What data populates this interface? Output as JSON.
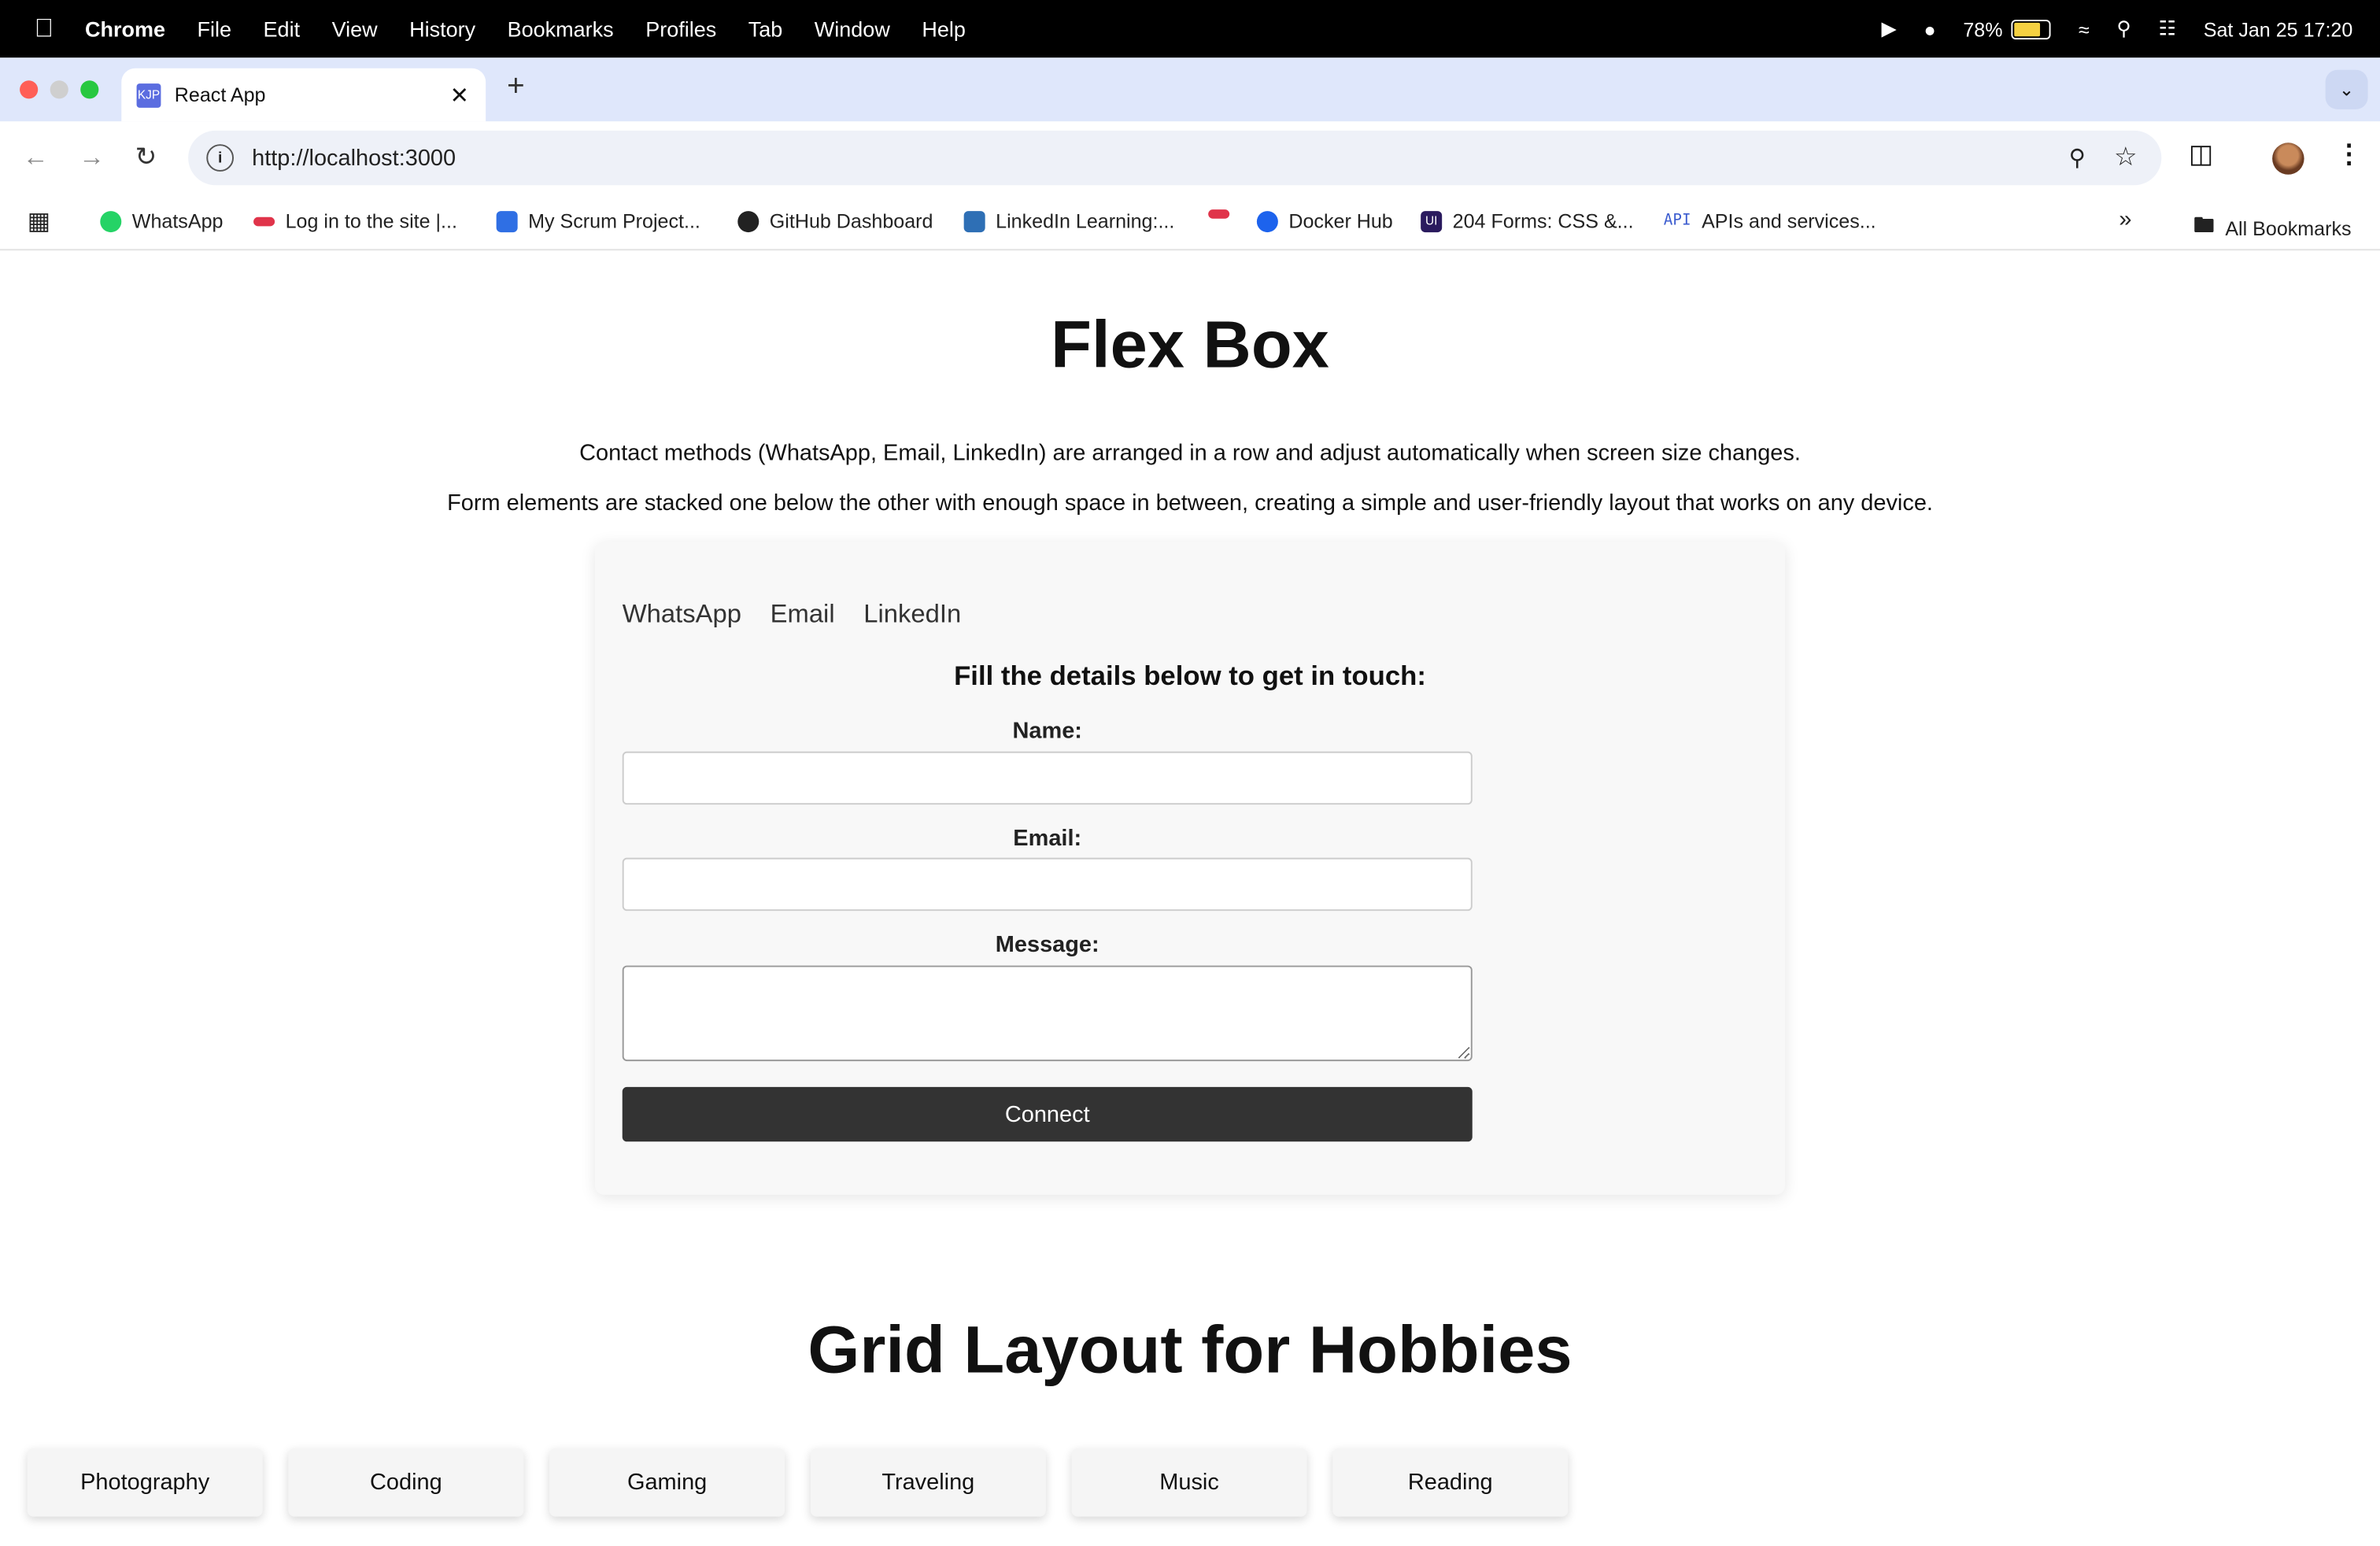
{
  "menubar": {
    "items": [
      "Chrome",
      "File",
      "Edit",
      "View",
      "History",
      "Bookmarks",
      "Profiles",
      "Tab",
      "Window",
      "Help"
    ],
    "battery": "78%",
    "datetime": "Sat Jan 25  17:20"
  },
  "tab": {
    "favicon_text": "KJP",
    "title": "React App"
  },
  "address": {
    "url": "http://localhost:3000"
  },
  "bookmarks": [
    {
      "label": "WhatsApp",
      "color": "#25d366"
    },
    {
      "label": "Log in to the site |...",
      "color": "#e0344a"
    },
    {
      "label": "My Scrum Project...",
      "color": "#2f6fe4"
    },
    {
      "label": "GitHub Dashboard",
      "color": "#222222"
    },
    {
      "label": "LinkedIn Learning:...",
      "color": "#2e6fb5"
    },
    {
      "label": "",
      "color": "#e0344a"
    },
    {
      "label": "Docker Hub",
      "color": "#1d63ed"
    },
    {
      "label": "204 Forms: CSS &...",
      "color": "#2a1a5e"
    },
    {
      "label": "APIs and services...",
      "color": "#3c5ccf"
    }
  ],
  "bookmarks_icon_texts": {
    "ui": "UI",
    "api": "API"
  },
  "all_bookmarks": "All Bookmarks",
  "page": {
    "flex_title": "Flex Box",
    "desc1": "Contact methods (WhatsApp, Email, LinkedIn) are arranged in a row and adjust automatically when screen size changes.",
    "desc2": "Form elements are stacked one below the other with enough space in between, creating a simple and user-friendly layout that works on any device.",
    "contacts": [
      "WhatsApp",
      "Email",
      "LinkedIn"
    ],
    "form_heading": "Fill the details below to get in touch:",
    "name_label": "Name:",
    "email_label": "Email:",
    "message_label": "Message:",
    "name_value": "",
    "email_value": "",
    "message_value": "",
    "connect_label": "Connect",
    "grid_title": "Grid Layout for Hobbies",
    "hobbies": [
      "Photography",
      "Coding",
      "Gaming",
      "Traveling",
      "Music",
      "Reading"
    ]
  }
}
